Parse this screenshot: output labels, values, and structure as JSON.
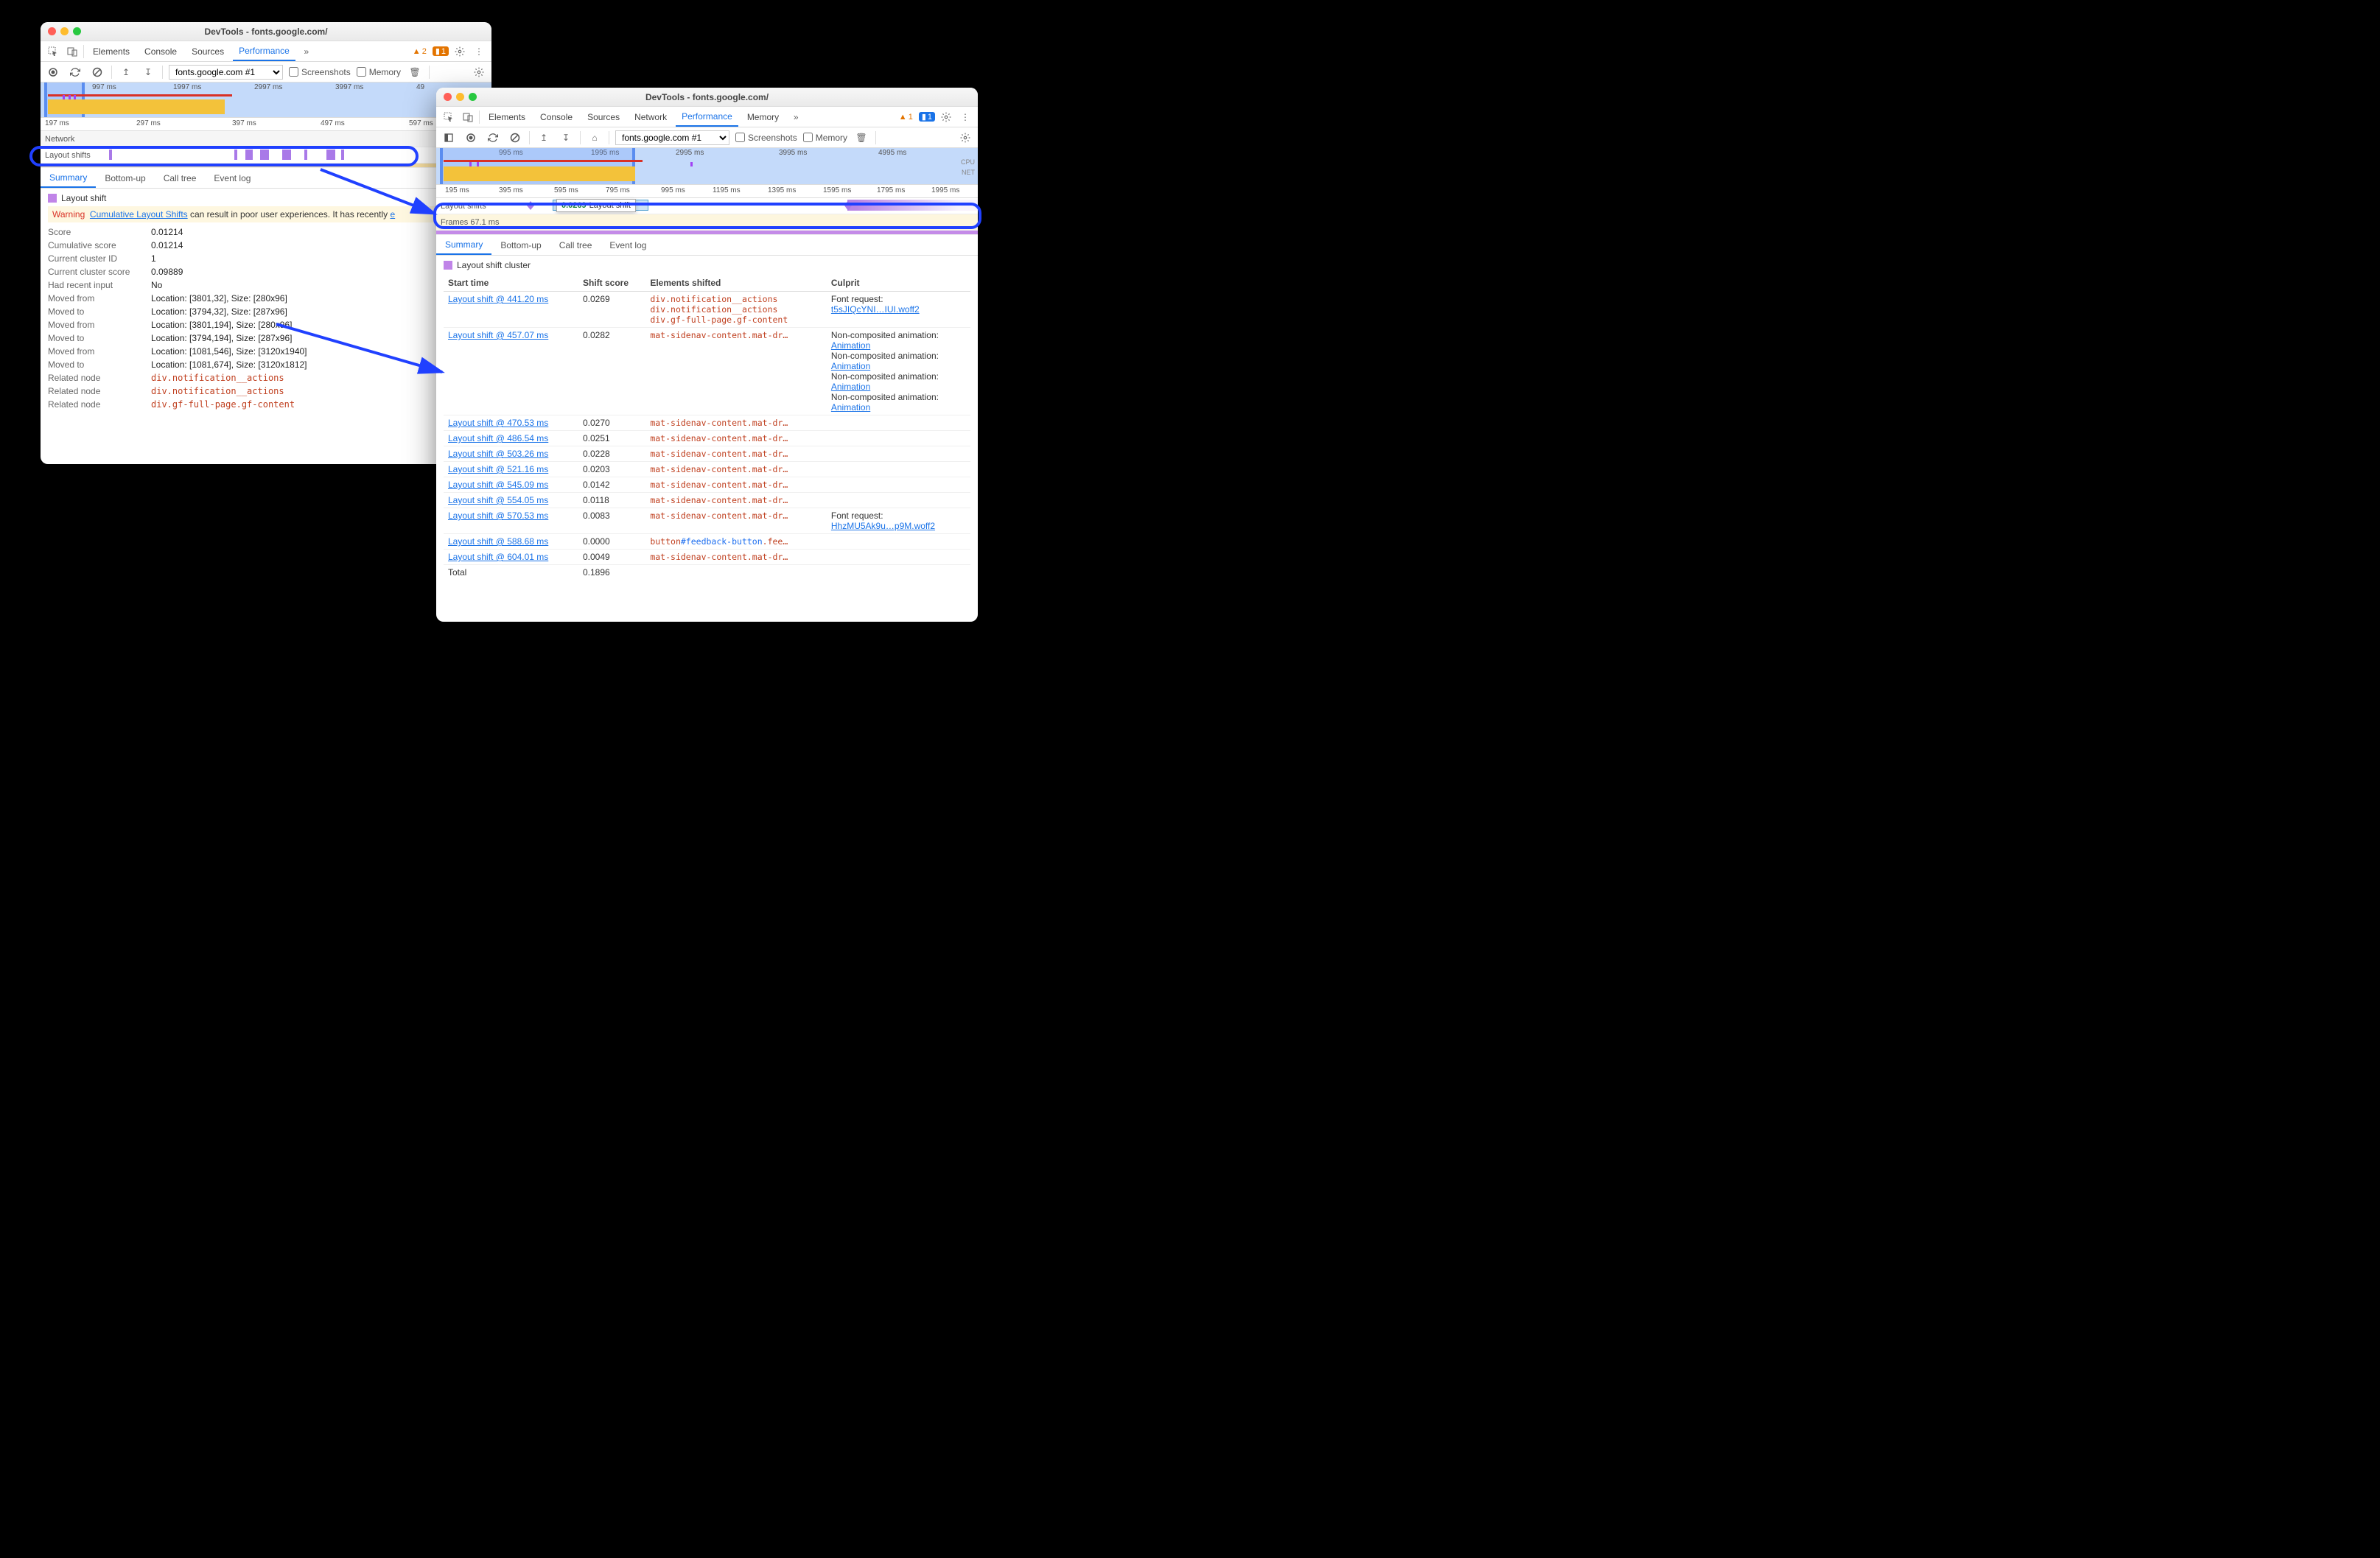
{
  "win1": {
    "title": "DevTools - fonts.google.com/",
    "tabs": [
      "Elements",
      "Console",
      "Sources",
      "Performance"
    ],
    "activeTab": "Performance",
    "warnCount": "2",
    "infoCount": "1",
    "recordingSelect": "fonts.google.com #1",
    "ck_screenshots": "Screenshots",
    "ck_memory": "Memory",
    "overview_ticks": [
      "997 ms",
      "1997 ms",
      "2997 ms",
      "3997 ms",
      "49"
    ],
    "ruler_ticks": [
      "197 ms",
      "297 ms",
      "397 ms",
      "497 ms",
      "597 ms"
    ],
    "track_layout_label": "Layout shifts",
    "sumtabs": [
      "Summary",
      "Bottom-up",
      "Call tree",
      "Event log"
    ],
    "activeSumTab": "Summary",
    "section_title": "Layout shift",
    "warning_label": "Warning",
    "warning_link": "Cumulative Layout Shifts",
    "warning_rest": " can result in poor user experiences. It has recently ",
    "kv": {
      "Score": "0.01214",
      "Cumulative score": "0.01214",
      "Current cluster ID": "1",
      "Current cluster score": "0.09889",
      "Had recent input": "No",
      "Moved from_1": "Location: [3801,32], Size: [280x96]",
      "Moved to_1": "Location: [3794,32], Size: [287x96]",
      "Moved from_2": "Location: [3801,194], Size: [280x96]",
      "Moved to_2": "Location: [3794,194], Size: [287x96]",
      "Moved from_3": "Location: [1081,546], Size: [3120x1940]",
      "Moved to_3": "Location: [1081,674], Size: [3120x1812]"
    },
    "related_nodes": [
      "div.notification__actions",
      "div.notification__actions",
      "div.gf-full-page.gf-content"
    ],
    "related_label": "Related node"
  },
  "win2": {
    "title": "DevTools - fonts.google.com/",
    "tabs": [
      "Elements",
      "Console",
      "Sources",
      "Network",
      "Performance",
      "Memory"
    ],
    "activeTab": "Performance",
    "warnCount": "1",
    "infoCount": "1",
    "recordingSelect": "fonts.google.com #1",
    "ck_screenshots": "Screenshots",
    "ck_memory": "Memory",
    "overview_ticks": [
      "995 ms",
      "1995 ms",
      "2995 ms",
      "3995 ms",
      "4995 ms"
    ],
    "ruler_ticks": [
      "195 ms",
      "395 ms",
      "595 ms",
      "795 ms",
      "995 ms",
      "1195 ms",
      "1395 ms",
      "1595 ms",
      "1795 ms",
      "1995 ms"
    ],
    "track_layout_label": "Layout shifts",
    "track_frames_label": "Frames 67.1 ms",
    "tooltip_score": "0.0269",
    "tooltip_text": "Layout shift",
    "sumtabs": [
      "Summary",
      "Bottom-up",
      "Call tree",
      "Event log"
    ],
    "activeSumTab": "Summary",
    "section_title": "Layout shift cluster",
    "table_headers": [
      "Start time",
      "Shift score",
      "Elements shifted",
      "Culprit"
    ],
    "rows": [
      {
        "start": "Layout shift @ 441.20 ms",
        "score": "0.0269",
        "elems": [
          "div.notification__actions",
          "div.notification__actions",
          "div.gf-full-page.gf-content"
        ],
        "culprit": {
          "label": "Font request:",
          "link": "t5sJIQcYNI…IUI.woff2"
        }
      },
      {
        "start": "Layout shift @ 457.07 ms",
        "score": "0.0282",
        "elems": [
          "mat-sidenav-content.mat-dr…"
        ],
        "culprit": {
          "label_multi": [
            "Non-composited animation:",
            "Non-composited animation:",
            "Non-composited animation:",
            "Non-composited animation:"
          ],
          "link": "Animation"
        }
      },
      {
        "start": "Layout shift @ 470.53 ms",
        "score": "0.0270",
        "elems": [
          "mat-sidenav-content.mat-dr…"
        ],
        "culprit": null
      },
      {
        "start": "Layout shift @ 486.54 ms",
        "score": "0.0251",
        "elems": [
          "mat-sidenav-content.mat-dr…"
        ],
        "culprit": null
      },
      {
        "start": "Layout shift @ 503.26 ms",
        "score": "0.0228",
        "elems": [
          "mat-sidenav-content.mat-dr…"
        ],
        "culprit": null
      },
      {
        "start": "Layout shift @ 521.16 ms",
        "score": "0.0203",
        "elems": [
          "mat-sidenav-content.mat-dr…"
        ],
        "culprit": null
      },
      {
        "start": "Layout shift @ 545.09 ms",
        "score": "0.0142",
        "elems": [
          "mat-sidenav-content.mat-dr…"
        ],
        "culprit": null
      },
      {
        "start": "Layout shift @ 554.05 ms",
        "score": "0.0118",
        "elems": [
          "mat-sidenav-content.mat-dr…"
        ],
        "culprit": null
      },
      {
        "start": "Layout shift @ 570.53 ms",
        "score": "0.0083",
        "elems": [
          "mat-sidenav-content.mat-dr…"
        ],
        "culprit": {
          "label": "Font request:",
          "link": "HhzMU5Ak9u…p9M.woff2"
        }
      },
      {
        "start": "Layout shift @ 588.68 ms",
        "score": "0.0000",
        "elems_special": {
          "tag": "button",
          "id": "#feedback-button",
          "rest": ".fee…"
        },
        "culprit": null
      },
      {
        "start": "Layout shift @ 604.01 ms",
        "score": "0.0049",
        "elems": [
          "mat-sidenav-content.mat-dr…"
        ],
        "culprit": null
      }
    ],
    "total_label": "Total",
    "total_score": "0.1896"
  },
  "chart_data": {
    "type": "table",
    "title": "Layout shift cluster",
    "columns": [
      "Start time (ms)",
      "Shift score"
    ],
    "rows": [
      [
        441.2,
        0.0269
      ],
      [
        457.07,
        0.0282
      ],
      [
        470.53,
        0.027
      ],
      [
        486.54,
        0.0251
      ],
      [
        503.26,
        0.0228
      ],
      [
        521.16,
        0.0203
      ],
      [
        545.09,
        0.0142
      ],
      [
        554.05,
        0.0118
      ],
      [
        570.53,
        0.0083
      ],
      [
        588.68,
        0.0
      ],
      [
        604.01,
        0.0049
      ]
    ],
    "total": 0.1896
  }
}
